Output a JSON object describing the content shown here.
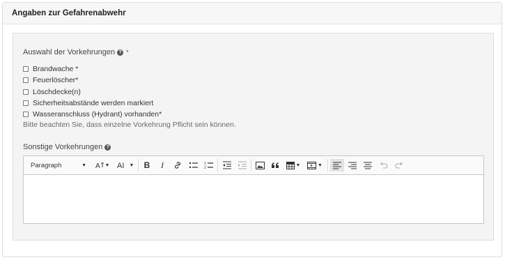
{
  "header": {
    "title": "Angaben zur Gefahrenabwehr"
  },
  "precautions": {
    "label": "Auswahl der Vorkehrungen",
    "required_mark": "*",
    "options": [
      {
        "label": "Brandwache *",
        "checked": false
      },
      {
        "label": "Feuerlöscher*",
        "checked": false
      },
      {
        "label": "Löschdecke(n)",
        "checked": false
      },
      {
        "label": "Sicherheitsabstände werden markiert",
        "checked": false
      },
      {
        "label": "Wasseranschluss (Hydrant) vorhanden*",
        "checked": false
      }
    ],
    "hint": "Bitte beachten Sie, dass einzelne Vorkehrung Pflicht sein können."
  },
  "other": {
    "label": "Sonstige Vorkehrungen",
    "editor": {
      "heading_select": "Paragraph",
      "content": ""
    }
  },
  "icons": {
    "help": "question-circle-icon",
    "toolbar": [
      "font-size-icon",
      "font-family-icon",
      "bold-icon",
      "italic-icon",
      "link-icon",
      "bulleted-list-icon",
      "numbered-list-icon",
      "outdent-icon",
      "indent-icon",
      "image-icon",
      "blockquote-icon",
      "table-icon",
      "media-embed-icon",
      "align-left-icon",
      "align-right-icon",
      "align-center-icon",
      "undo-icon",
      "redo-icon"
    ]
  }
}
